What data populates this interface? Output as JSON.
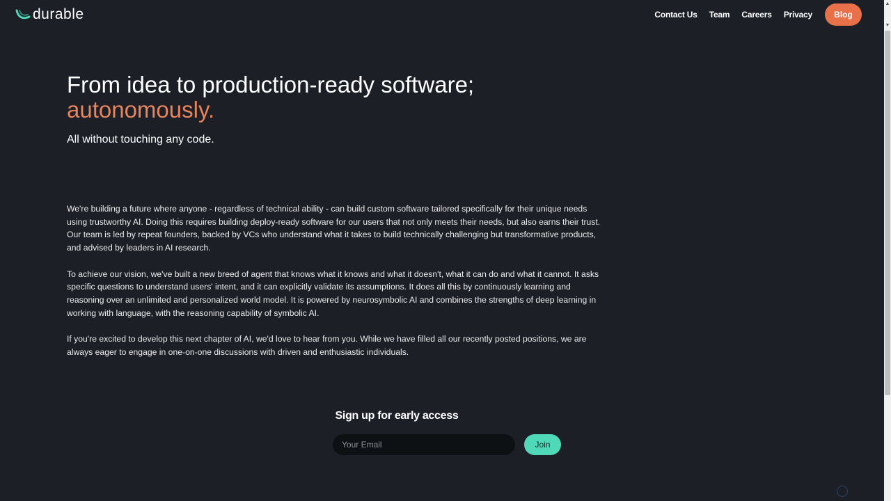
{
  "brand": {
    "name": "durable",
    "accent_color": "#4fd9b9",
    "logo_icon": "swoosh-icon"
  },
  "nav": {
    "links": [
      "Contact Us",
      "Team",
      "Careers",
      "Privacy"
    ],
    "blog_label": "Blog"
  },
  "hero": {
    "title": "From idea to production-ready software;",
    "title_accent": "autonomously.",
    "subtitle": "All without touching any code."
  },
  "body": {
    "paragraphs": [
      "We're building a future where anyone - regardless of technical ability - can build custom software tailored specifically for their unique needs using trustworthy AI. Doing this requires building deploy-ready software for our users that not only meets their needs, but also earns their trust. Our team is led by repeat founders, backed by VCs who understand what it takes to build technically challenging but transformative products, and advised by leaders in AI research.",
      "To achieve our vision, we've built a new breed of agent that knows what it knows and what it doesn't, what it can do and what it cannot. It asks specific questions to understand users' intent, and it can explicitly validate its assumptions. It does all this by continuously learning and reasoning over an unlimited and personalized world model. It is powered by neurosymbolic AI and combines the strengths of deep learning in working with language, with the reasoning capability of symbolic AI.",
      "If you're excited to develop this next chapter of AI, we'd love to hear from you. While we have filled all our recently posted positions, we are always eager to engage in one-on-one discussions with driven and enthusiastic individuals."
    ]
  },
  "signup": {
    "title": "Sign up for early access",
    "email_placeholder": "Your Email",
    "join_label": "Join"
  },
  "colors": {
    "background": "#1c1f26",
    "blog_button": "#e8714a",
    "title_accent": "#e8845c",
    "join_button": "#4fd9b9"
  }
}
